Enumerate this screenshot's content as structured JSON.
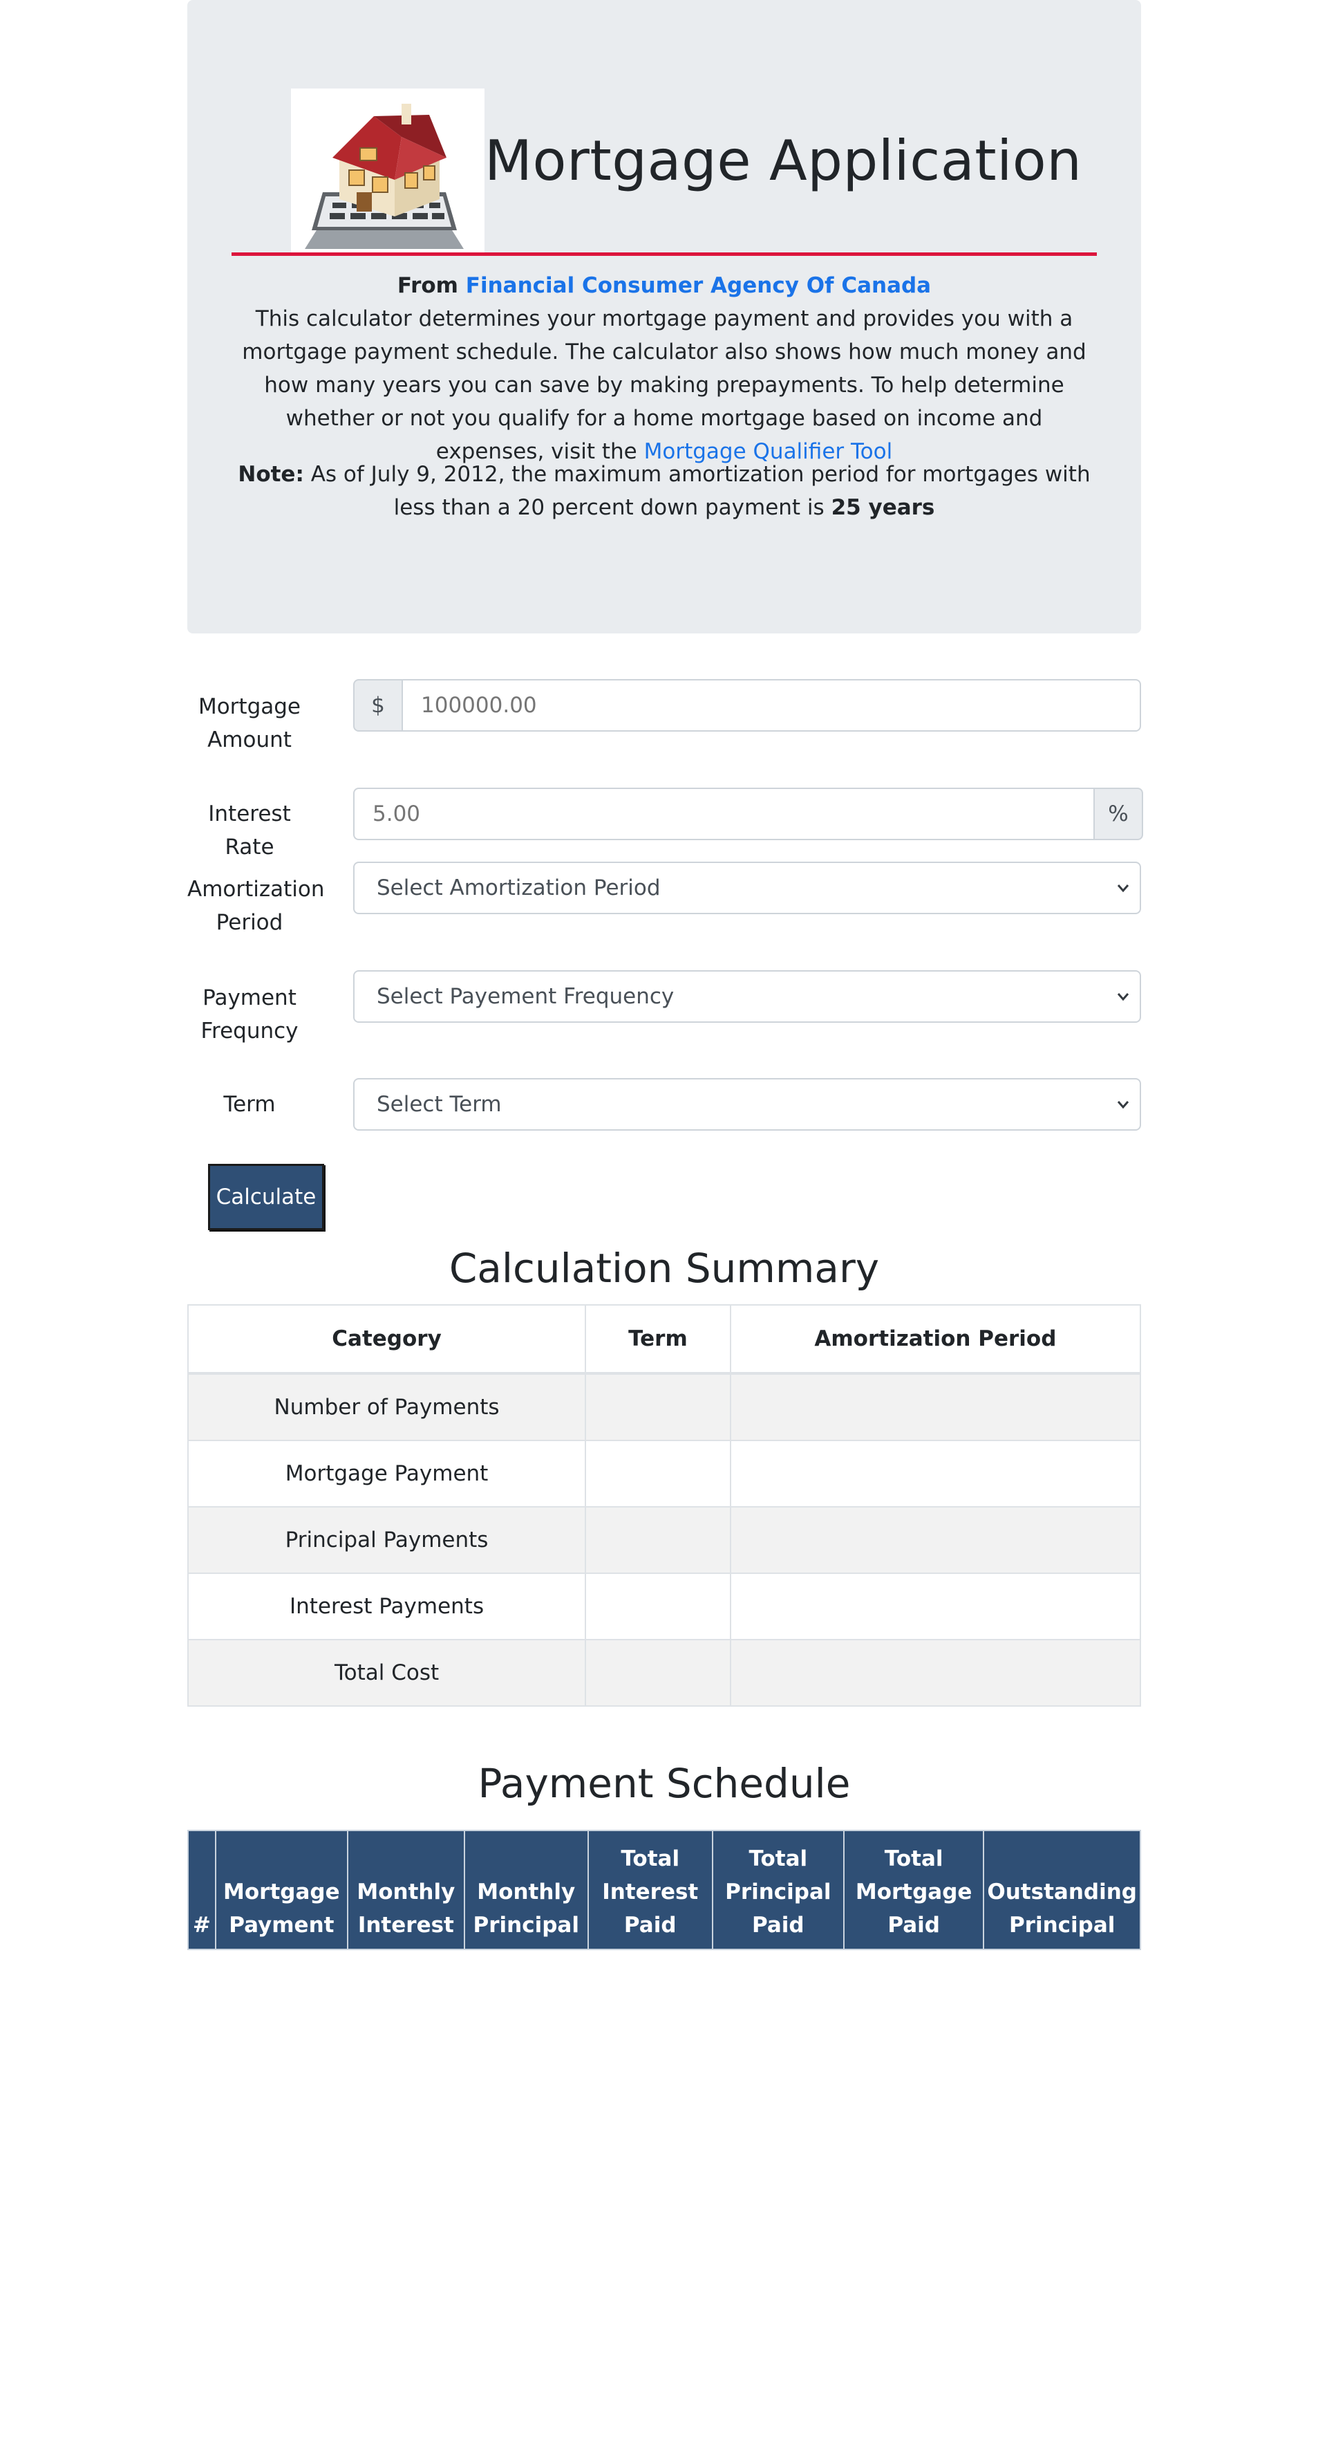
{
  "header": {
    "title": "Mortgage Application",
    "from_label": "From",
    "from_link": "Financial Consumer Agency Of Canada",
    "description": "This calculator determines your mortgage payment and provides you with a mortgage payment schedule. The calculator also shows how much money and how many years you can save by making prepayments. To help determine whether or not you qualify for a home mortgage based on income and expenses, visit the",
    "qualifier_link": "Mortgage Qualifier Tool",
    "note_label": "Note:",
    "note_text": "As of July 9, 2012, the maximum amortization period for mortgages with less than a 20 percent down payment is",
    "note_bold": "25 years"
  },
  "form": {
    "mortgage_amount": {
      "label_line1": "Mortgage",
      "label_line2": "Amount",
      "prefix": "$",
      "placeholder": "100000.00"
    },
    "interest_rate": {
      "label": "Interest Rate",
      "placeholder": "5.00",
      "suffix": "%"
    },
    "amortization": {
      "label_line1": "Amortization",
      "label_line2": "Period",
      "selected": "Select Amortization Period"
    },
    "frequency": {
      "label_line1": "Payment",
      "label_line2": "Frequncy",
      "selected": "Select Payement Frequency"
    },
    "term": {
      "label": "Term",
      "selected": "Select Term"
    },
    "calculate_label": "Calculate"
  },
  "summary": {
    "title": "Calculation Summary",
    "headers": [
      "Category",
      "Term",
      "Amortization Period"
    ],
    "rows": [
      "Number of Payments",
      "Mortgage Payment",
      "Principal Payments",
      "Interest Payments",
      "Total Cost"
    ]
  },
  "schedule": {
    "title": "Payment Schedule",
    "headers": [
      "#",
      "Mortgage Payment",
      "Monthly Interest",
      "Monthly Principal",
      "Total Interest Paid",
      "Total Principal Paid",
      "Total Mortgage Paid",
      "Outstanding Principal"
    ]
  },
  "colors": {
    "jumbotron_bg": "#e9ecef",
    "accent_rule": "#dc143c",
    "link": "#1a73e8",
    "button_bg": "#2f4f75",
    "schedule_header_bg": "#2f4f75"
  },
  "icons": {
    "logo": "house-on-calculator-icon",
    "select_caret": "chevron-down-icon"
  }
}
